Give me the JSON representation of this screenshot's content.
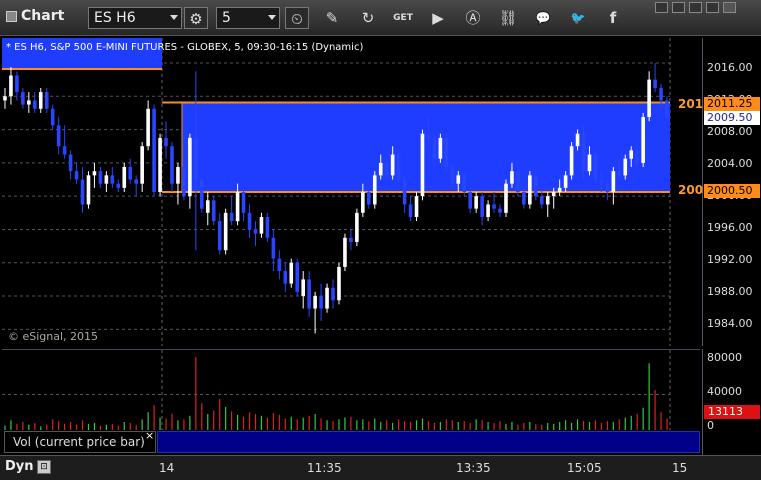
{
  "toolbar": {
    "title": "Chart",
    "symbol": "ES H6",
    "interval": "5",
    "buttons": [
      {
        "name": "settings",
        "glyph": "⚙"
      },
      {
        "name": "time",
        "glyph": "⏲"
      },
      {
        "name": "draw",
        "glyph": "✎"
      },
      {
        "name": "refresh",
        "glyph": "↻"
      },
      {
        "name": "get",
        "glyph": "GET"
      },
      {
        "name": "play",
        "glyph": "▶"
      },
      {
        "name": "alert",
        "glyph": "Ⓐ"
      },
      {
        "name": "link",
        "glyph": "⛓"
      },
      {
        "name": "comment",
        "glyph": "💬"
      },
      {
        "name": "twitter",
        "glyph": "🐦"
      },
      {
        "name": "facebook",
        "glyph": "f"
      }
    ]
  },
  "chart": {
    "header": "* ES H6, S&P 500 E-MINI FUTURES - GLOBEX, 5, 09:30-16:15 (Dynamic)",
    "copyright": "© eSignal, 2015",
    "colors": {
      "up": "#ffffff",
      "down": "#2a45ff",
      "band": "#1f3dff",
      "level": "#ff8c1a"
    },
    "price_axis": {
      "ticks": [
        "2016.00",
        "2012.00",
        "2008.00",
        "2004.00",
        "2000.00",
        "1996.00",
        "1992.00",
        "1988.00",
        "1984.00"
      ],
      "upper_level_label": "2011.25",
      "upper_level_left_label": "201",
      "last_price_label": "2009.50",
      "lower_level_label": "2000.50",
      "lower_level_left_label": "200"
    }
  },
  "volume": {
    "label": "Vol (current price bar)",
    "close": "×",
    "ticks": [
      "80000",
      "40000",
      "0"
    ],
    "last_value": "13113"
  },
  "time_axis": {
    "mode": "Dyn",
    "labels": [
      "14",
      "11:35",
      "13:35",
      "15:05",
      "15"
    ]
  },
  "chart_data": {
    "type": "candlestick",
    "symbol": "ES H6",
    "ylim": [
      1982,
      2019
    ],
    "levels": [
      2011.25,
      2000.5
    ],
    "last_price": 2009.5,
    "bars": [
      [
        2011.5,
        2013.0,
        2010.5,
        2012.0
      ],
      [
        2012.0,
        2015.5,
        2011.0,
        2014.5
      ],
      [
        2014.5,
        2015.0,
        2011.5,
        2012.5
      ],
      [
        2012.5,
        2013.0,
        2010.5,
        2011.0
      ],
      [
        2011.0,
        2012.5,
        2010.0,
        2011.5
      ],
      [
        2011.5,
        2012.5,
        2010.0,
        2010.5
      ],
      [
        2010.5,
        2013.0,
        2010.0,
        2012.5
      ],
      [
        2012.5,
        2013.0,
        2010.0,
        2010.5
      ],
      [
        2010.5,
        2011.0,
        2008.0,
        2008.5
      ],
      [
        2008.5,
        2009.5,
        2005.0,
        2006.0
      ],
      [
        2006.0,
        2008.5,
        2004.5,
        2005.0
      ],
      [
        2005.0,
        2005.5,
        2002.0,
        2003.0
      ],
      [
        2003.0,
        2004.0,
        2001.5,
        2002.0
      ],
      [
        2002.0,
        2003.5,
        1998.0,
        1999.0
      ],
      [
        1999.0,
        2003.0,
        1998.5,
        2002.5
      ],
      [
        2002.5,
        2004.0,
        2001.0,
        2003.0
      ],
      [
        2003.0,
        2003.5,
        2001.0,
        2001.5
      ],
      [
        2001.5,
        2003.0,
        2000.5,
        2002.5
      ],
      [
        2002.5,
        2003.5,
        2001.0,
        2001.5
      ],
      [
        2001.5,
        2002.0,
        2000.5,
        2001.0
      ],
      [
        2001.0,
        2004.0,
        2000.5,
        2003.5
      ],
      [
        2003.5,
        2004.5,
        2001.5,
        2002.0
      ],
      [
        2002.0,
        2002.5,
        2000.0,
        2001.5
      ],
      [
        2001.5,
        2006.5,
        2000.5,
        2006.0
      ],
      [
        2006.0,
        2011.5,
        2005.5,
        2010.5
      ],
      [
        2010.5,
        2011.0,
        2000.0,
        2000.5
      ],
      [
        2000.5,
        2007.5,
        2000.0,
        2007.0
      ],
      [
        2007.0,
        2009.0,
        2004.5,
        2006.0
      ],
      [
        2006.0,
        2006.5,
        2000.5,
        2001.5
      ],
      [
        2001.5,
        2004.0,
        1999.0,
        2003.5
      ],
      [
        2003.5,
        2004.5,
        1999.5,
        2000.0
      ],
      [
        2000.0,
        2007.5,
        1998.5,
        2007.0
      ],
      [
        2007.0,
        2015.0,
        1993.5,
        2002.0
      ],
      [
        2002.0,
        2002.5,
        1998.0,
        1998.5
      ],
      [
        1998.0,
        2000.5,
        1996.5,
        1999.5
      ],
      [
        1999.5,
        2000.0,
        1996.5,
        1997.0
      ],
      [
        1997.0,
        1998.0,
        1993.0,
        1993.5
      ],
      [
        1993.5,
        1998.5,
        1993.0,
        1998.0
      ],
      [
        1998.0,
        2000.0,
        1996.5,
        1997.0
      ],
      [
        1997.0,
        2001.5,
        1996.5,
        2000.5
      ],
      [
        2000.5,
        2001.0,
        1997.0,
        1998.0
      ],
      [
        1998.0,
        1999.0,
        1995.0,
        1996.0
      ],
      [
        1996.0,
        1997.0,
        1994.0,
        1995.5
      ],
      [
        1995.5,
        1998.0,
        1995.0,
        1997.5
      ],
      [
        1997.5,
        1998.0,
        1994.5,
        1995.0
      ],
      [
        1995.0,
        1996.0,
        1991.0,
        1992.5
      ],
      [
        1992.5,
        1993.5,
        1990.0,
        1991.0
      ],
      [
        1991.0,
        1992.0,
        1988.5,
        1989.5
      ],
      [
        1989.5,
        1992.5,
        1989.0,
        1992.0
      ],
      [
        1992.0,
        1992.5,
        1988.0,
        1988.5
      ],
      [
        1988.0,
        1991.0,
        1986.5,
        1990.0
      ],
      [
        1990.0,
        1991.0,
        1985.5,
        1986.5
      ],
      [
        1986.5,
        1988.5,
        1983.5,
        1988.0
      ],
      [
        1988.0,
        1989.5,
        1985.0,
        1986.5
      ],
      [
        1986.5,
        1989.5,
        1986.0,
        1989.0
      ],
      [
        1989.0,
        1990.0,
        1986.5,
        1987.5
      ],
      [
        1987.5,
        1992.0,
        1987.0,
        1991.5
      ],
      [
        1991.5,
        1995.5,
        1991.0,
        1995.0
      ],
      [
        1995.0,
        1996.0,
        1993.5,
        1994.5
      ],
      [
        1994.5,
        1998.5,
        1994.0,
        1998.0
      ],
      [
        1998.0,
        2001.5,
        1997.5,
        2000.5
      ],
      [
        2000.5,
        2001.0,
        1998.5,
        1999.0
      ],
      [
        1999.0,
        2003.0,
        1998.5,
        2002.5
      ],
      [
        2002.5,
        2005.0,
        2002.0,
        2004.0
      ],
      [
        2004.0,
        2005.0,
        2002.0,
        2002.5
      ],
      [
        2002.5,
        2006.0,
        2002.0,
        2005.0
      ],
      [
        2005.0,
        2005.5,
        2001.5,
        2002.0
      ],
      [
        2002.0,
        2002.5,
        1998.0,
        1999.0
      ],
      [
        1999.0,
        2000.0,
        1997.0,
        1997.5
      ],
      [
        1997.5,
        2000.5,
        1997.0,
        2000.0
      ],
      [
        2000.0,
        2008.0,
        1999.5,
        2007.5
      ],
      [
        2007.5,
        2009.5,
        2006.0,
        2007.0
      ],
      [
        2007.0,
        2007.5,
        2003.5,
        2004.5
      ],
      [
        2004.5,
        2007.5,
        2004.0,
        2007.0
      ],
      [
        2007.0,
        2007.5,
        2003.0,
        2003.5
      ],
      [
        2003.5,
        2004.0,
        2001.0,
        2001.5
      ],
      [
        2001.5,
        2003.0,
        2000.5,
        2002.5
      ],
      [
        2002.5,
        2003.0,
        2000.0,
        2000.5
      ],
      [
        2000.5,
        2001.0,
        1998.0,
        1998.5
      ],
      [
        1998.5,
        2000.5,
        1998.0,
        2000.0
      ],
      [
        2000.0,
        2000.5,
        1996.5,
        1997.5
      ],
      [
        1997.5,
        1999.5,
        1997.0,
        1999.0
      ],
      [
        1999.0,
        2000.5,
        1998.0,
        1998.5
      ],
      [
        1998.5,
        1999.0,
        1997.5,
        1998.0
      ],
      [
        1998.0,
        2002.0,
        1997.5,
        2001.5
      ],
      [
        2001.5,
        2004.0,
        2001.0,
        2003.0
      ],
      [
        2003.0,
        2003.5,
        2000.0,
        2000.5
      ],
      [
        2000.5,
        2001.0,
        1998.5,
        1999.0
      ],
      [
        1999.0,
        2003.0,
        1998.5,
        2002.5
      ],
      [
        2002.5,
        2003.0,
        1999.5,
        2000.0
      ],
      [
        2000.0,
        2001.0,
        1998.5,
        1999.0
      ],
      [
        1999.0,
        2000.5,
        1997.5,
        2000.0
      ],
      [
        2000.0,
        2001.0,
        1998.5,
        2000.5
      ],
      [
        2000.5,
        2002.0,
        2000.0,
        2001.0
      ],
      [
        2001.0,
        2003.0,
        2000.5,
        2002.5
      ],
      [
        2002.5,
        2006.5,
        2002.0,
        2006.0
      ],
      [
        2006.0,
        2008.0,
        2005.5,
        2007.5
      ],
      [
        2007.5,
        2008.5,
        2002.0,
        2003.0
      ],
      [
        2003.0,
        2006.0,
        2002.5,
        2005.0
      ],
      [
        2005.0,
        2005.5,
        2001.5,
        2002.0
      ],
      [
        2002.0,
        2003.0,
        2000.5,
        2001.5
      ],
      [
        2001.5,
        2002.0,
        1999.5,
        2000.5
      ],
      [
        2000.5,
        2003.5,
        1999.0,
        2003.0
      ],
      [
        2003.0,
        2004.5,
        2002.0,
        2002.5
      ],
      [
        2002.5,
        2005.0,
        2002.0,
        2004.5
      ],
      [
        2004.5,
        2006.0,
        2003.5,
        2005.5
      ],
      [
        2005.5,
        2006.5,
        2003.5,
        2004.0
      ],
      [
        2004.0,
        2010.0,
        2003.5,
        2009.5
      ],
      [
        2009.5,
        2015.0,
        2009.0,
        2014.0
      ],
      [
        2014.0,
        2016.0,
        2012.5,
        2013.0
      ],
      [
        2013.0,
        2013.5,
        2010.5,
        2011.5
      ],
      [
        2011.5,
        2012.0,
        2009.0,
        2009.5
      ]
    ],
    "volume": [
      5000,
      11000,
      7000,
      9000,
      6000,
      8000,
      4000,
      6000,
      12000,
      10000,
      7000,
      9000,
      6000,
      11000,
      7000,
      8000,
      5000,
      6000,
      7000,
      5000,
      9000,
      8000,
      6000,
      12000,
      20000,
      28000,
      14000,
      13000,
      18000,
      11000,
      12000,
      16000,
      82000,
      30000,
      18000,
      22000,
      35000,
      26000,
      21000,
      17000,
      15000,
      20000,
      18000,
      16000,
      14000,
      19000,
      17000,
      13000,
      15000,
      12000,
      14000,
      16000,
      18000,
      13000,
      11000,
      10000,
      12000,
      14000,
      15000,
      11000,
      12000,
      10000,
      13000,
      9000,
      11000,
      8000,
      12000,
      10000,
      9000,
      11000,
      13000,
      10000,
      8000,
      9000,
      12000,
      11000,
      9000,
      10000,
      8000,
      12000,
      11000,
      9000,
      8000,
      10000,
      7000,
      9000,
      6000,
      8000,
      9000,
      7000,
      6000,
      8000,
      7000,
      9000,
      11000,
      8000,
      12000,
      10000,
      9000,
      11000,
      8000,
      10000,
      9000,
      12000,
      14000,
      16000,
      18000,
      25000,
      75000,
      45000,
      20000,
      13113
    ]
  }
}
